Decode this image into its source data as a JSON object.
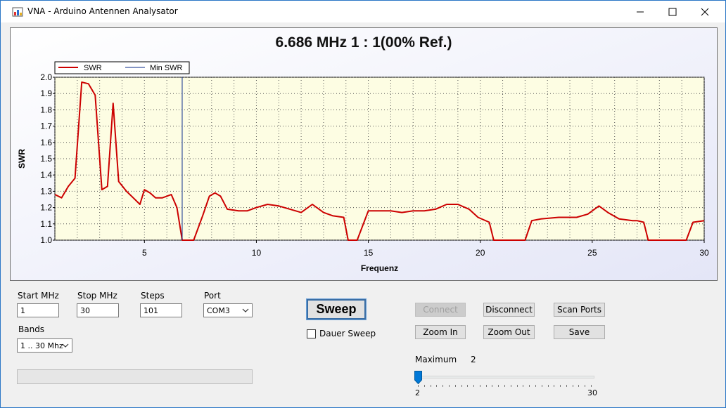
{
  "window": {
    "title": "VNA - Arduino Antennen Analysator",
    "icon": "app-chart-icon",
    "controls": [
      "minimize-icon",
      "maximize-icon",
      "close-icon"
    ]
  },
  "chart_header": "6.686 MHz   1 : 1(00% Ref.)",
  "chart_data": {
    "type": "line",
    "title": "6.686 MHz   1 : 1(00% Ref.)",
    "xlabel": "Frequenz",
    "ylabel": "SWR",
    "xlim": [
      1,
      30
    ],
    "ylim": [
      1.0,
      2.0
    ],
    "x_ticks": [
      5,
      10,
      15,
      20,
      25,
      30
    ],
    "y_ticks": [
      1.0,
      1.1,
      1.2,
      1.3,
      1.4,
      1.5,
      1.6,
      1.7,
      1.8,
      1.9,
      2.0
    ],
    "grid": true,
    "legend_placement": "top-left",
    "background": "#fdfde3",
    "series": [
      {
        "name": "SWR",
        "color": "#cc0000",
        "x": [
          1.0,
          1.3,
          1.6,
          1.9,
          2.2,
          2.5,
          2.8,
          3.1,
          3.35,
          3.6,
          3.85,
          4.2,
          4.5,
          4.8,
          5.0,
          5.25,
          5.5,
          5.8,
          6.0,
          6.2,
          6.45,
          6.686,
          7.2,
          7.6,
          7.9,
          8.15,
          8.4,
          8.7,
          9.2,
          9.6,
          10.0,
          10.5,
          11.0,
          11.5,
          12.0,
          12.5,
          13.0,
          13.4,
          13.9,
          14.1,
          14.5,
          15.0,
          15.5,
          16.0,
          16.5,
          17.0,
          17.5,
          18.0,
          18.5,
          19.0,
          19.5,
          19.9,
          20.4,
          20.6,
          21.0,
          22.0,
          22.3,
          22.7,
          23.5,
          24.3,
          24.8,
          25.3,
          25.7,
          26.2,
          26.8,
          27.0,
          27.3,
          27.5,
          28.5,
          29.2,
          29.5,
          30.0
        ],
        "y": [
          1.28,
          1.26,
          1.33,
          1.38,
          1.97,
          1.96,
          1.89,
          1.31,
          1.33,
          1.84,
          1.36,
          1.3,
          1.26,
          1.22,
          1.31,
          1.29,
          1.26,
          1.26,
          1.27,
          1.28,
          1.2,
          1.0,
          1.0,
          1.15,
          1.27,
          1.29,
          1.27,
          1.19,
          1.18,
          1.18,
          1.2,
          1.22,
          1.21,
          1.19,
          1.17,
          1.22,
          1.17,
          1.15,
          1.14,
          1.0,
          1.0,
          1.18,
          1.18,
          1.18,
          1.17,
          1.18,
          1.18,
          1.19,
          1.22,
          1.22,
          1.19,
          1.14,
          1.11,
          1.0,
          1.0,
          1.0,
          1.12,
          1.13,
          1.14,
          1.14,
          1.16,
          1.21,
          1.17,
          1.13,
          1.12,
          1.12,
          1.11,
          1.0,
          1.0,
          1.0,
          1.11,
          1.12
        ]
      },
      {
        "name": "Min SWR",
        "color": "#0a2a8a",
        "x": [
          6.686,
          6.686
        ],
        "y": [
          1.0,
          2.0
        ]
      }
    ]
  },
  "controls": {
    "start_label": "Start MHz",
    "start_value": "1",
    "stop_label": "Stop MHz",
    "stop_value": "30",
    "steps_label": "Steps",
    "steps_value": "101",
    "port_label": "Port",
    "port_value": "COM3",
    "bands_label": "Bands",
    "bands_value": "1 .. 30 Mhz",
    "sweep_label": "Sweep",
    "dauer_label": "Dauer Sweep",
    "dauer_checked": false,
    "connect_label": "Connect",
    "disconnect_label": "Disconnect",
    "scan_label": "Scan Ports",
    "zoomin_label": "Zoom In",
    "zoomout_label": "Zoom Out",
    "save_label": "Save",
    "maximum_label": "Maximum",
    "maximum_value": "2",
    "slider_min": "2",
    "slider_max": "30",
    "slider_level": 0.0,
    "progress": 0.0
  }
}
